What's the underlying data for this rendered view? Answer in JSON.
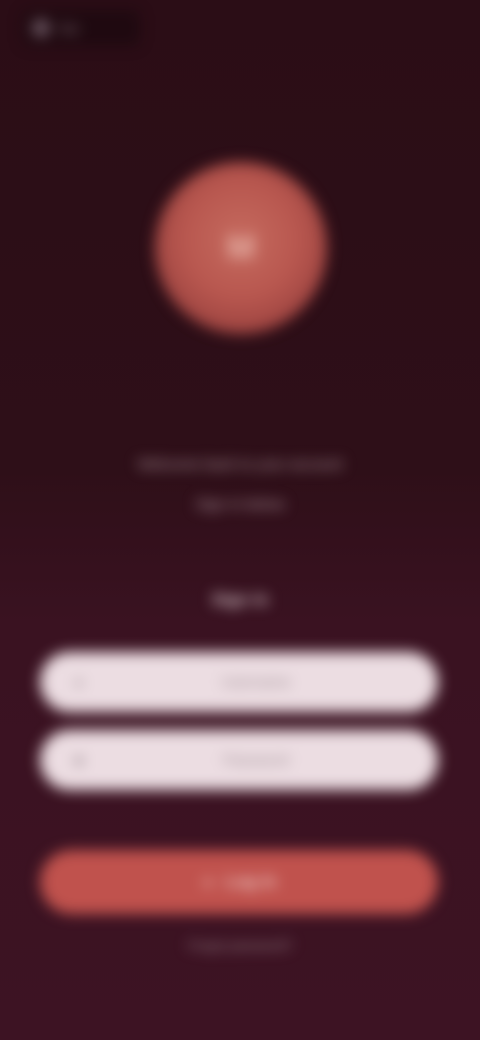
{
  "status": {
    "icon": "app-icon",
    "label": "App"
  },
  "avatar": {
    "initial": "M",
    "color": "#b8574f"
  },
  "tagline": {
    "line1": "Welcome back to your account",
    "line2": "Sign in below"
  },
  "login": {
    "title": "Sign in",
    "username_placeholder": "Username",
    "password_placeholder": "Password",
    "submit_label": "Log in",
    "footer": "Forgot password?"
  },
  "colors": {
    "background": "#2e0f18",
    "accent": "#c0524d",
    "field": "#ecdde2"
  }
}
